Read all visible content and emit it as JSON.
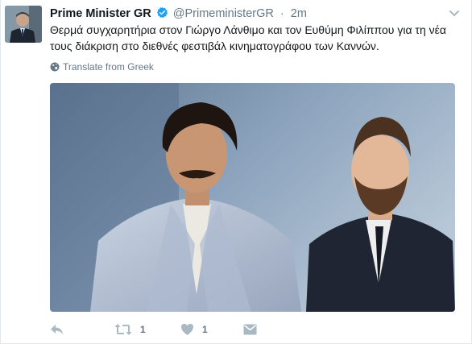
{
  "tweet": {
    "author_name": "Prime Minister GR",
    "screen_name": "@PrimeministerGR",
    "separator": "·",
    "time": "2m",
    "text": "Θερμά συγχαρητήρια στον Γιώργο Λάνθιμο και τον Ευθύμη Φιλίππου για τη νέα τους διάκριση στο διεθνές φεστιβάλ κινηματογράφου των Καννών.",
    "translate_label": "Translate from Greek",
    "retweet_count": "1",
    "like_count": "1"
  },
  "icons": {
    "verified": "verified-badge-icon",
    "more": "chevron-down-icon",
    "translate": "globe-icon",
    "reply": "reply-icon",
    "retweet": "retweet-icon",
    "like": "heart-icon",
    "message": "direct-message-icon"
  },
  "colors": {
    "verified": "#1da1f2",
    "icon_gray": "#aab8c2",
    "meta_gray": "#657786"
  }
}
